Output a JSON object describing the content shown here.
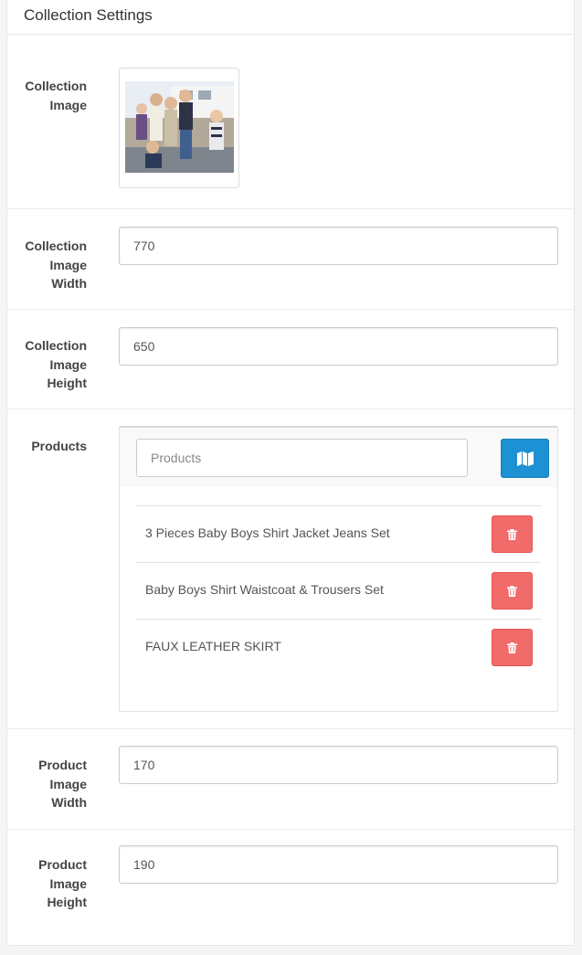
{
  "panel": {
    "title": "Collection Settings"
  },
  "collection_image": {
    "label_line1": "Collection",
    "label_line2": "Image",
    "alt": "Collection image"
  },
  "collection_image_width": {
    "label_line1": "Collection",
    "label_line2": "Image",
    "label_line3": "Width",
    "value": "770"
  },
  "collection_image_height": {
    "label_line1": "Collection",
    "label_line2": "Image",
    "label_line3": "Height",
    "value": "650"
  },
  "products": {
    "label": "Products",
    "search_placeholder": "Products",
    "items": [
      {
        "name": "3 Pieces Baby Boys Shirt Jacket Jeans Set"
      },
      {
        "name": "Baby Boys Shirt Waistcoat & Trousers Set"
      },
      {
        "name": "FAUX LEATHER SKIRT"
      }
    ],
    "button_color": "#1e90d4",
    "delete_color": "#f16b6b"
  },
  "product_image_width": {
    "label_line1": "Product",
    "label_line2": "Image",
    "label_line3": "Width",
    "value": "170"
  },
  "product_image_height": {
    "label_line1": "Product",
    "label_line2": "Image",
    "label_line3": "Height",
    "value": "190"
  }
}
